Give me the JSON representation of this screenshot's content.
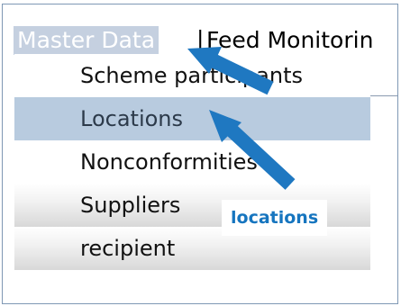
{
  "menubar": {
    "master_data": "Master Data",
    "separator": "|",
    "feed_monitoring": "Feed Monitorin"
  },
  "dropdown": {
    "items": [
      {
        "label": "Scheme participants",
        "selected": false
      },
      {
        "label": "Locations",
        "selected": true
      },
      {
        "label": "Nonconformities",
        "selected": false
      },
      {
        "label": "Suppliers",
        "selected": false
      },
      {
        "label": "recipient",
        "selected": false
      }
    ]
  },
  "annotation": {
    "callout_text": "locations",
    "arrow_color": "#1f78c1"
  },
  "colors": {
    "selected_bg": "#b8cbdf",
    "menu_highlight": "#c5d0e0",
    "callout_text": "#1675bf"
  }
}
